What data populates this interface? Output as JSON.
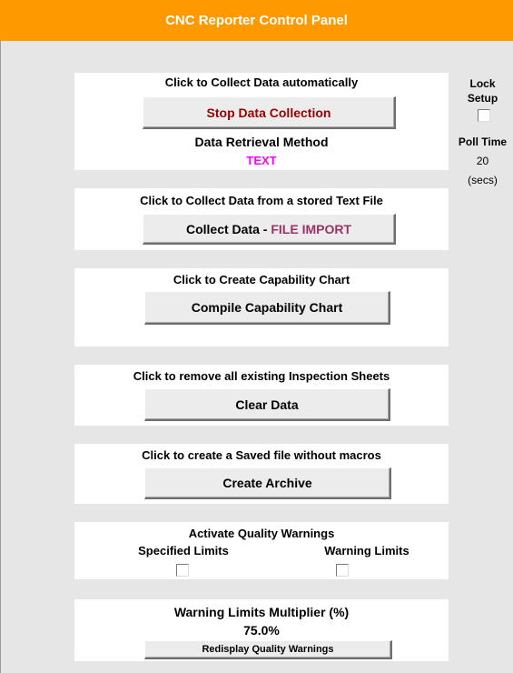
{
  "title": "CNC Reporter Control Panel",
  "collect_auto": {
    "heading": "Click to Collect Data automatically",
    "button_label": "Stop Data Collection",
    "method_label": "Data Retrieval Method",
    "method_value": "TEXT"
  },
  "side": {
    "lock_label_1": "Lock",
    "lock_label_2": "Setup",
    "poll_label": "Poll Time",
    "poll_value": "20",
    "poll_unit": "(secs)"
  },
  "file_import": {
    "heading": "Click to Collect Data from a stored Text File",
    "button_prefix": "Collect Data - ",
    "button_suffix": "FILE IMPORT"
  },
  "capability": {
    "heading": "Click to Create Capability Chart",
    "button_label": "Compile Capability Chart"
  },
  "clear": {
    "heading": "Click to remove all existing Inspection Sheets",
    "button_label": "Clear Data"
  },
  "archive": {
    "heading": "Click to create a Saved file without macros",
    "button_label": "Create Archive"
  },
  "quality": {
    "heading": "Activate Quality Warnings",
    "specified_label": "Specified Limits",
    "warning_label": "Warning Limits"
  },
  "multiplier": {
    "heading": "Warning Limits Multiplier (%)",
    "value": "75.0%",
    "button_label": "Redisplay Quality Warnings"
  },
  "colors": {
    "title_bar": "#ff9900",
    "stop_button_text": "#990000",
    "method_value": "#ff00ff",
    "file_import_text": "#993366"
  }
}
